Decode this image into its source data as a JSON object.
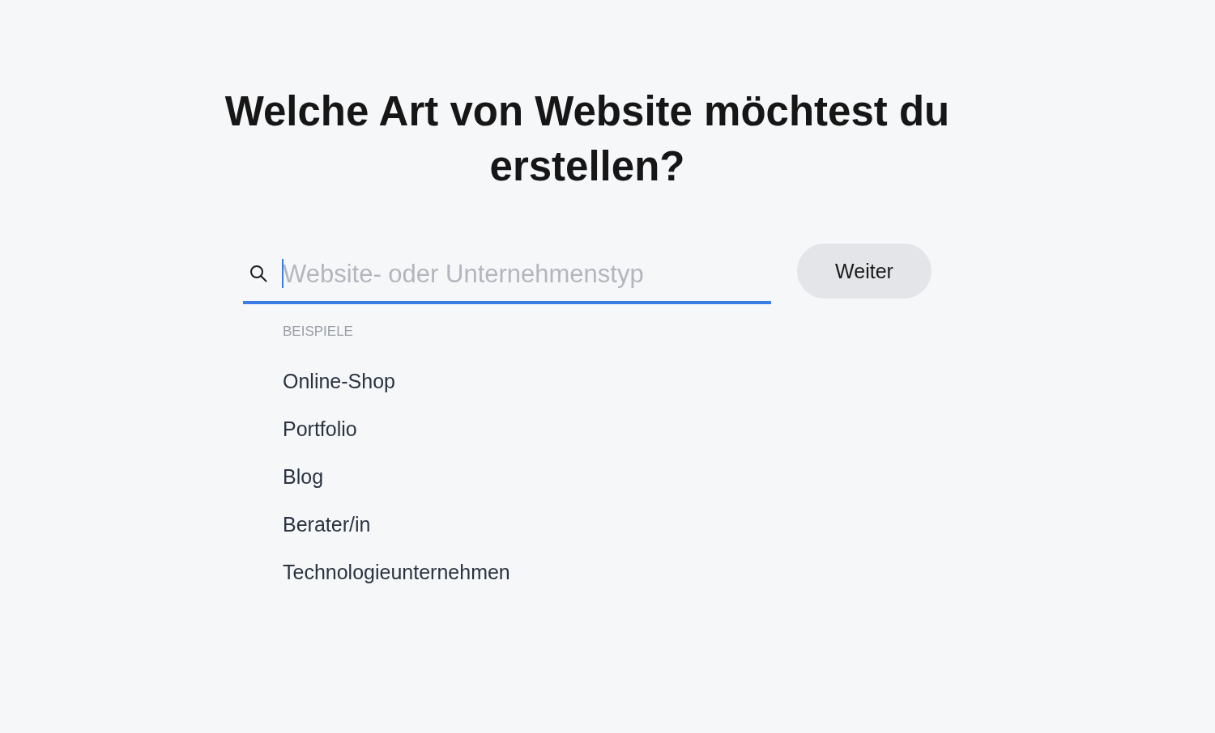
{
  "heading": "Welche Art von Website möchtest du erstellen?",
  "search": {
    "placeholder": "Website- oder Unternehmenstyp",
    "focused": true
  },
  "continue_button": "Weiter",
  "examples": {
    "label": "BEISPIELE",
    "items": [
      "Online-Shop",
      "Portfolio",
      "Blog",
      "Berater/in",
      "Technologieunternehmen"
    ]
  }
}
